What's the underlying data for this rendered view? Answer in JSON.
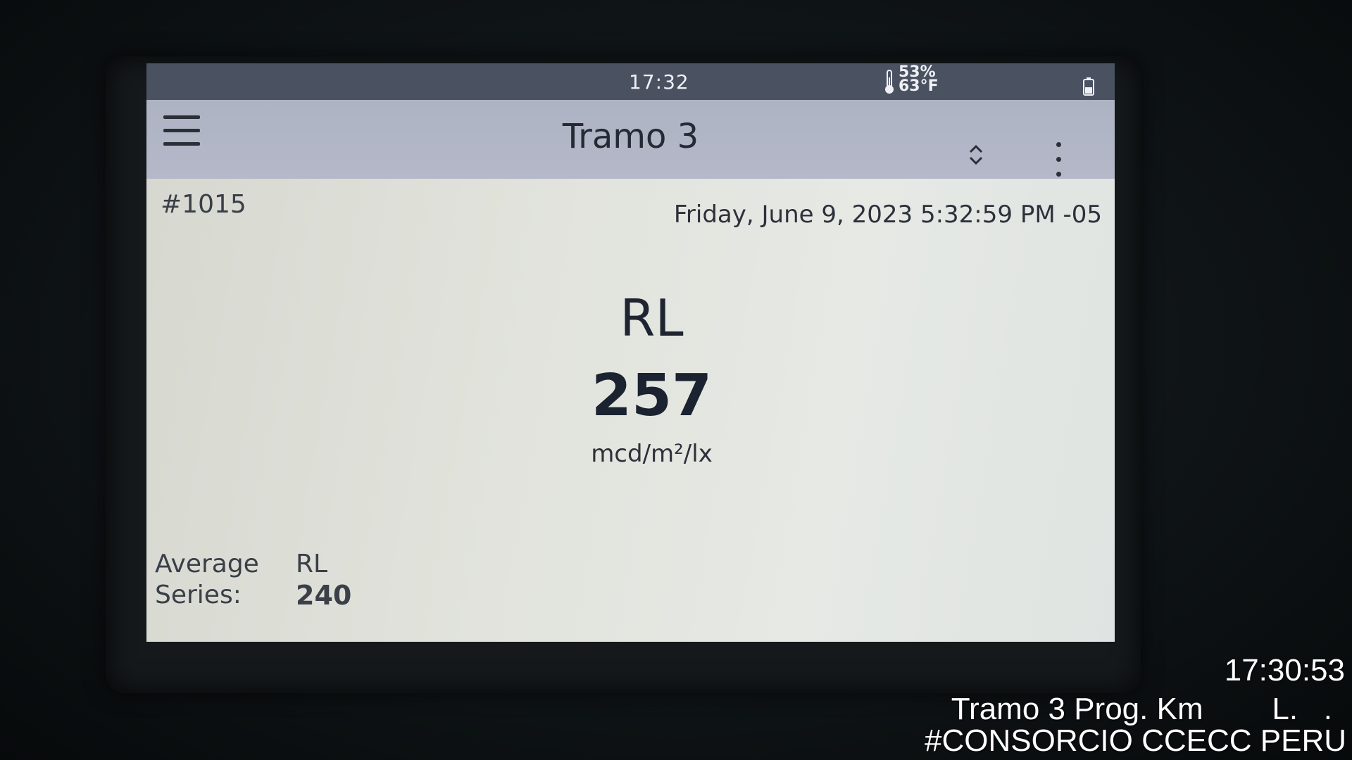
{
  "status_bar": {
    "time": "17:32",
    "humidity": "53%",
    "temperature": "63°F",
    "thermometer_icon": "thermometer-icon",
    "battery_icon": "battery-icon"
  },
  "app_bar": {
    "menu_icon": "hamburger-menu-icon",
    "title": "Tramo 3",
    "sort_icon": "chevron-up-down-icon",
    "more_icon": "more-vertical-icon"
  },
  "record": {
    "number": "#1015",
    "timestamp": "Friday, June 9, 2023 5:32:59 PM -05"
  },
  "measurement": {
    "label": "RL",
    "value": "257",
    "unit": "mcd/m²/lx"
  },
  "average": {
    "caption_line1": "Average",
    "caption_line2": "Series:",
    "label": "RL",
    "value": "240"
  },
  "photo_overlay": {
    "time": "17:30:53",
    "line1": "Tramo 3 Prog. Km        L.   .",
    "line2": "#CONSORCIO CCECC PERU"
  },
  "colors": {
    "status_bar_bg": "#4a5161",
    "app_bar_bg": "#b4b8c8",
    "screen_bg": "#e1e3dc",
    "text_dark": "#1f2530"
  }
}
